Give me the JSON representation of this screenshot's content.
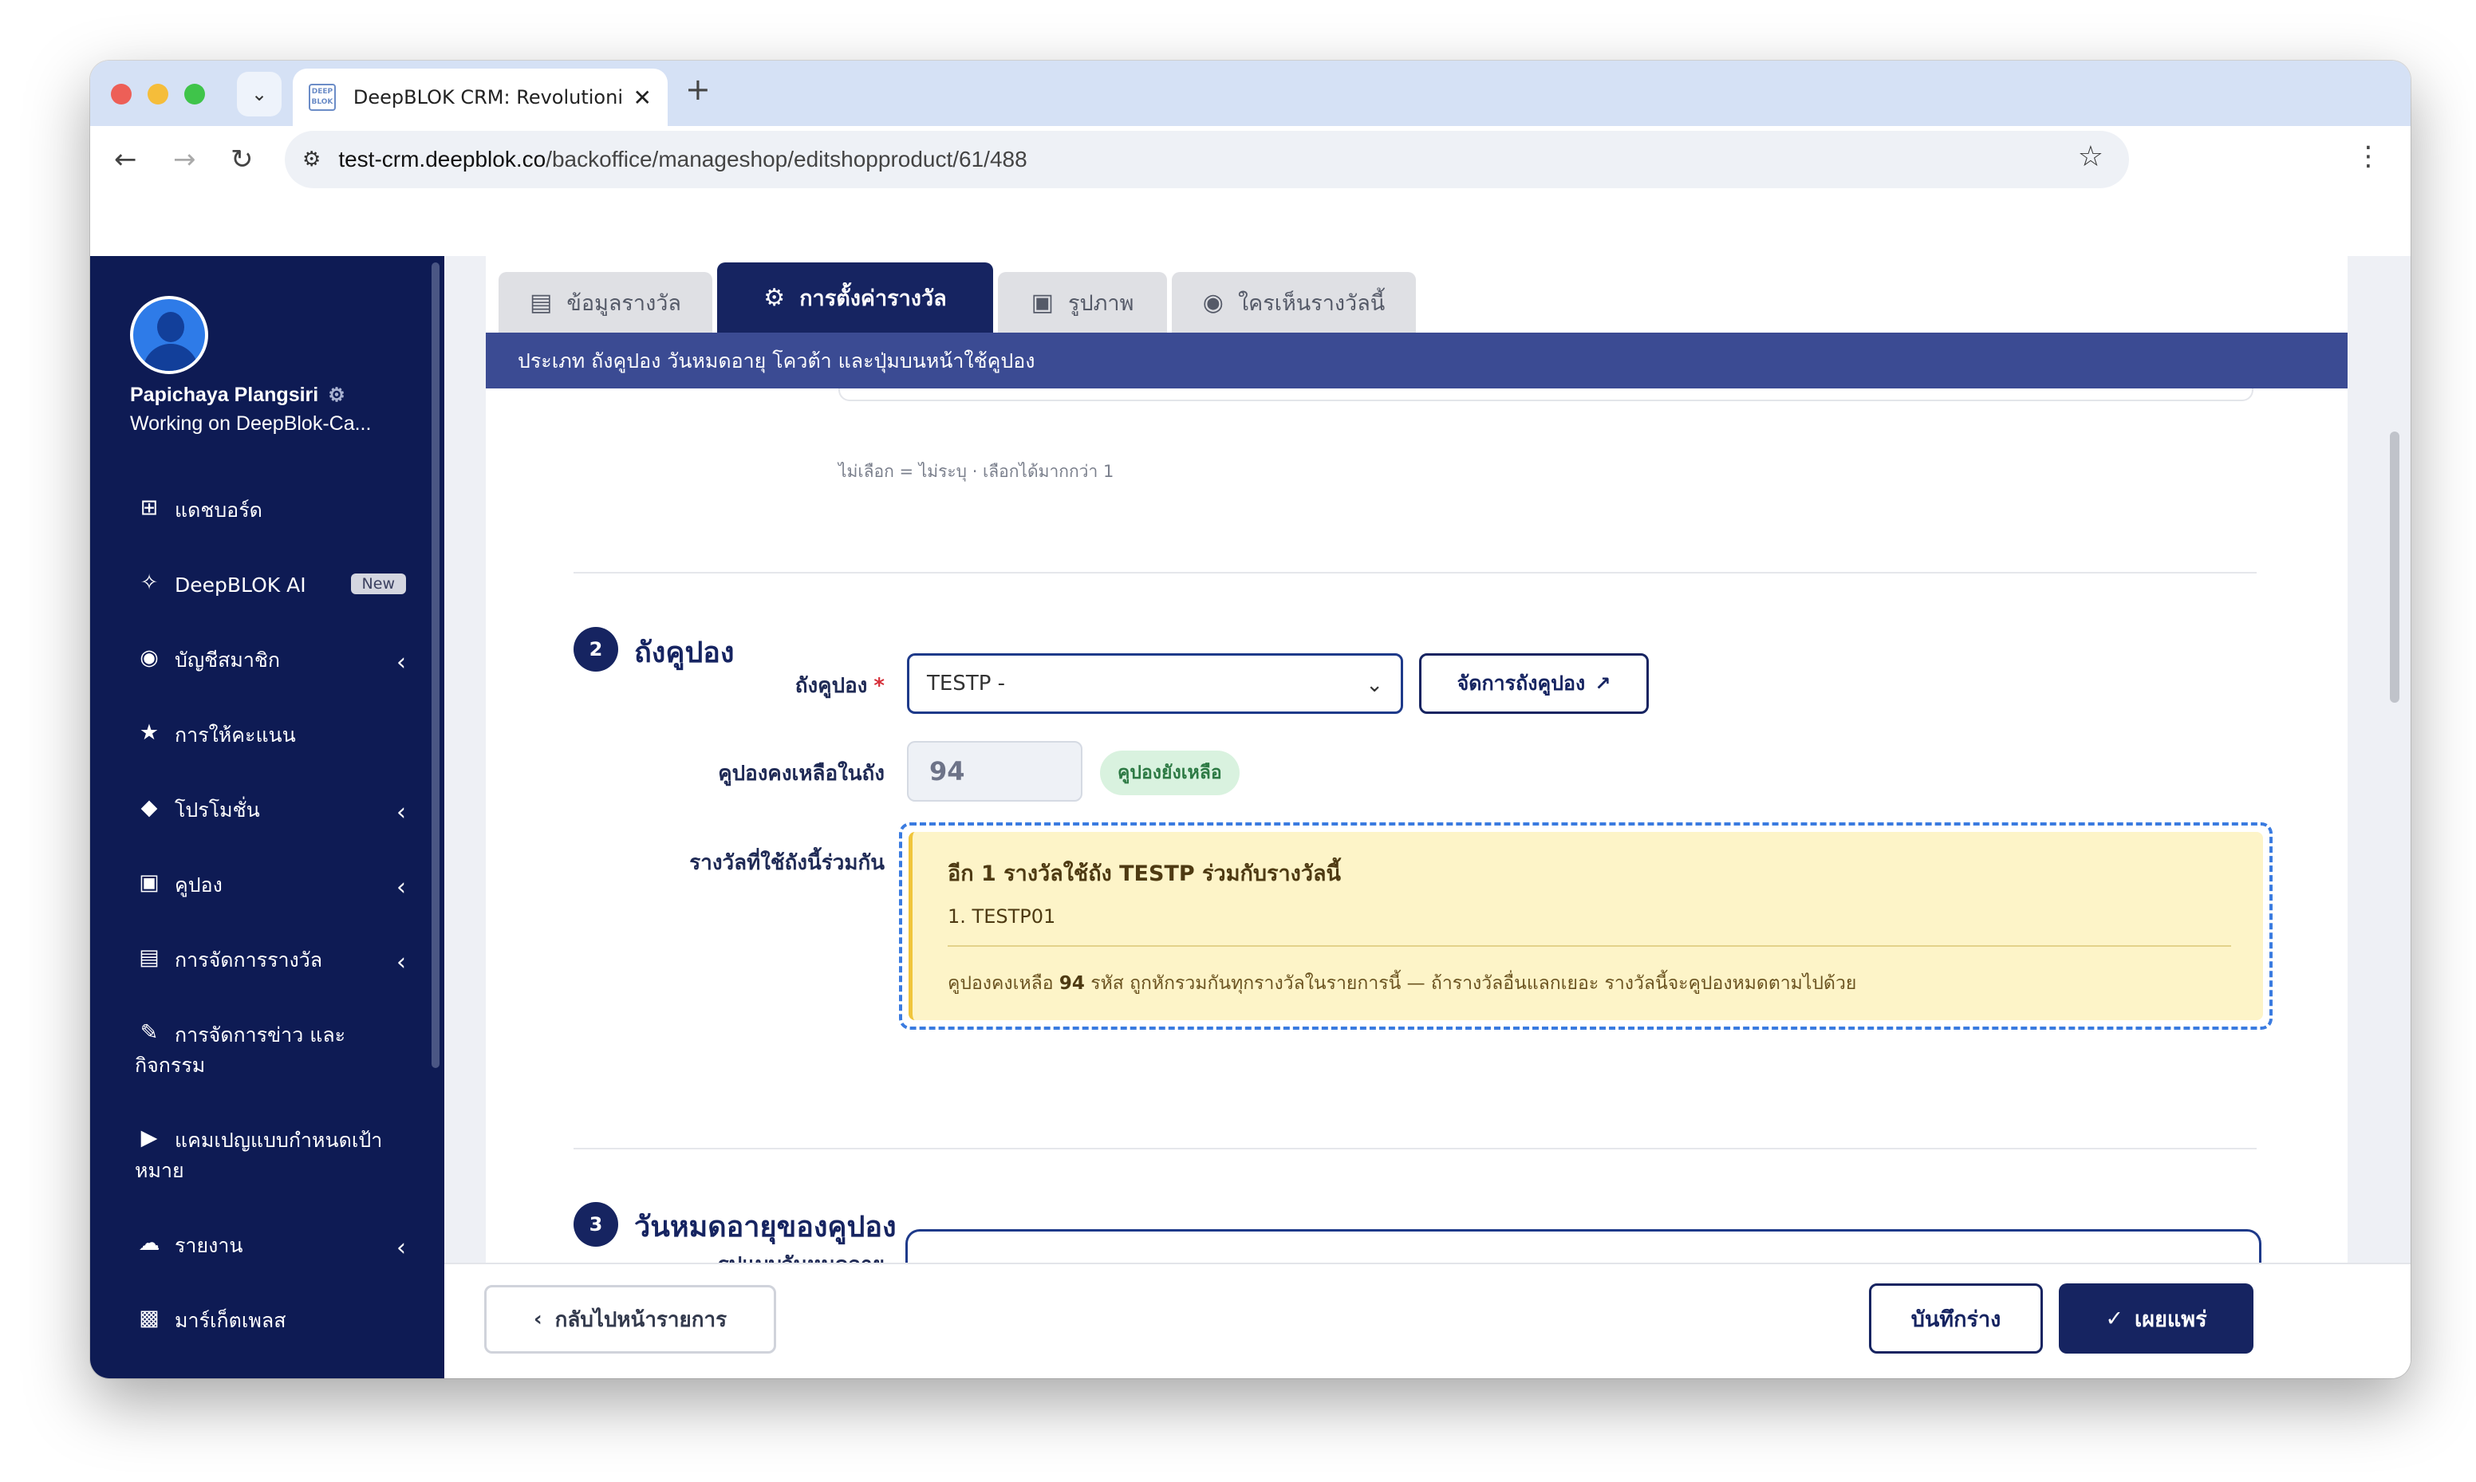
{
  "browser": {
    "tab_title": "DeepBLOK CRM: Revolutioniz",
    "favicon_text": "DEEP BLOK",
    "url_host": "test-crm.deepblok.co",
    "url_path": "/backoffice/manageshop/editshopproduct/61/488"
  },
  "sidebar": {
    "user_name": "Papichaya Plangsiri",
    "workspace": "Working on DeepBlok-Ca...",
    "items": [
      {
        "icon": "dashboard-icon",
        "label": "แดชบอร์ด"
      },
      {
        "icon": "sparkle-icon",
        "label": "DeepBLOK AI",
        "badge": "New"
      },
      {
        "icon": "users-icon",
        "label": "บัญชีสมาชิก"
      },
      {
        "icon": "star-icon",
        "label": "การให้คะแนน"
      },
      {
        "icon": "tag-icon",
        "label": "โปรโมชั่น"
      },
      {
        "icon": "ticket-icon",
        "label": "คูปอง"
      },
      {
        "icon": "cart-icon",
        "label": "การจัดการรางวัล"
      },
      {
        "icon": "edit-icon",
        "label_line1": "การจัดการข่าว และ",
        "label_line2": "กิจกรรม"
      },
      {
        "icon": "megaphone-icon",
        "label_line1": "แคมเปญแบบกำหนดเป้า",
        "label_line2": "หมาย"
      },
      {
        "icon": "cloud-download-icon",
        "label": "รายงาน"
      },
      {
        "icon": "bag-icon",
        "label": "มาร์เก็ตเพลส"
      }
    ]
  },
  "tabs": [
    {
      "icon": "clipboard-icon",
      "label": "ข้อมูลรางวัล",
      "active": false
    },
    {
      "icon": "gear-icon",
      "label": "การตั้งค่ารางวัล",
      "active": true
    },
    {
      "icon": "image-icon",
      "label": "รูปภาพ",
      "active": false
    },
    {
      "icon": "users-icon",
      "label": "ใครเห็นรางวัลนี้",
      "active": false
    }
  ],
  "tab_description": "ประเภท ถังคูปอง วันหมดอายุ โควต้า และปุ่มบนหน้าใช้คูปอง",
  "previous_hint": "ไม่เลือก = ไม่ระบุ · เลือกได้มากกว่า 1",
  "section2": {
    "number": "2",
    "title": "ถังคูปอง",
    "pool_label": "ถังคูปอง",
    "required_mark": "*",
    "pool_value": "TESTP -",
    "manage_button": "จัดการถังคูปอง",
    "remaining_label": "คูปองคงเหลือในถัง",
    "remaining_value": "94",
    "remaining_status": "คูปองยังเหลือ",
    "shared_label": "รางวัลที่ใช้ถังนี้ร่วมกัน",
    "shared_title": "อีก 1 รางวัลใช้ถัง TESTP ร่วมกับรางวัลนี้",
    "shared_items": [
      "1. TESTP01"
    ],
    "shared_note_prefix": "คูปองคงเหลือ",
    "shared_note_count": "94",
    "shared_note_suffix": "รหัส ถูกหักรวมกันทุกรางวัลในรายการนี้ — ถ้ารางวัลอื่นแลกเยอะ รางวัลนี้จะคูปองหมดตามไปด้วย"
  },
  "section3": {
    "number": "3",
    "title": "วันหมดอายุของคูปอง",
    "expiry_label": "รูปแบบวันหมดอายุ"
  },
  "footer": {
    "back_label": "กลับไปหน้ารายการ",
    "draft_label": "บันทึกร่าง",
    "publish_label": "เผยแพร่"
  },
  "colors": {
    "sidebar_bg": "#0e1b54",
    "primary": "#162461",
    "tab_strip": "#3b4b93",
    "warning_bg": "#fdf4c8",
    "dashed_border": "#3a7be0",
    "success_pill": "#d9f2df"
  }
}
